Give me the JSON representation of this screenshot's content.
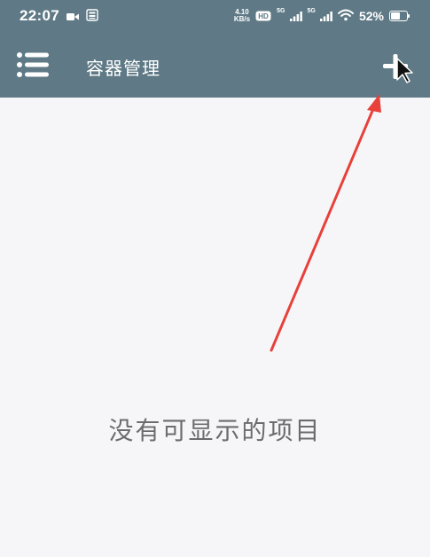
{
  "status_bar": {
    "time": "22:07",
    "net_speed_value": "4.10",
    "net_speed_unit": "KB/s",
    "signal_1_label": "5G",
    "signal_2_label": "5G",
    "battery_percent": "52%",
    "icons": [
      "video-icon",
      "sim-card-icon",
      "hd-icon",
      "signal-icon",
      "wifi-icon",
      "battery-icon"
    ]
  },
  "toolbar": {
    "title": "容器管理",
    "menu_icon": "menu-list-icon",
    "add_icon": "plus-icon"
  },
  "content": {
    "empty_message": "没有可显示的项目"
  },
  "colors": {
    "toolbar_bg": "#5f7a86",
    "content_bg": "#f6f6f8",
    "annotation_arrow": "#e8403a"
  }
}
